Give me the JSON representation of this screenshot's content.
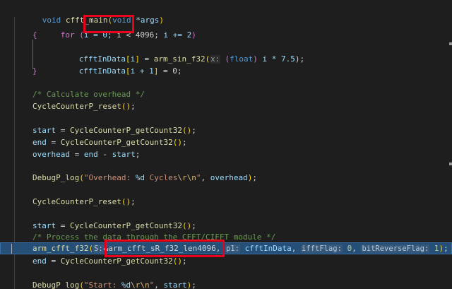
{
  "editor": {
    "function_signature": {
      "keyword": "void",
      "name": "cfft_main",
      "param_type": "void",
      "param_name": "*args"
    },
    "lines": {
      "for": {
        "kw": "for",
        "init": "i = 0;",
        "cond": "i < 4096;",
        "incr": "i += 2"
      },
      "brace_open": "{",
      "sin_call": {
        "target": "cfftInData",
        "index": "i",
        "fn": "arm_sin_f32",
        "hint": "x:",
        "cast": "float",
        "rest": "i * 7.5",
        "end": ");"
      },
      "zero_assign": {
        "target": "cfftInData",
        "index": "i + 1",
        "rest": " = 0;"
      },
      "brace_close": "}",
      "comment_overhead": "/* Calculate overhead */",
      "reset1": "CycleCounterP_reset",
      "start1": {
        "var": "start",
        "fn": "CycleCounterP_getCount32"
      },
      "end1": {
        "var": "end",
        "fn": "CycleCounterP_getCount32"
      },
      "overhead": {
        "var": "overhead",
        "a": "end",
        "b": "start"
      },
      "log_overhead": {
        "fn": "DebugP_log",
        "fmt_a": "\"Overhead: ",
        "fmt_b": "%d",
        "fmt_c": " Cycles",
        "fmt_d": "\\r\\n",
        "fmt_e": "\"",
        "arg": "overhead"
      },
      "reset2": "CycleCounterP_reset",
      "start2": {
        "var": "start",
        "fn": "CycleCounterP_getCount32"
      },
      "comment_process": "/* Process the data through the CFFT/CIFFT module */",
      "cfft_call": {
        "fn": "arm_cfft_f32",
        "hint_s": "S:",
        "instance": "&arm_cfft_sR_f32_len4096",
        "hint_p1": "p1:",
        "p1": "cfftInData",
        "hint_ifft": "ifftFlag:",
        "ifft": "0",
        "hint_bitrev": "bitReverseFlag:",
        "bitrev": "1"
      },
      "end2": {
        "var": "end",
        "fn": "CycleCounterP_getCount32"
      },
      "log_start": {
        "fn": "DebugP_log",
        "fmt_a": "\"Start: ",
        "fmt_b": "%d",
        "fmt_d": "\\r\\n",
        "fmt_e": "\"",
        "arg": "start"
      }
    }
  },
  "colors": {
    "background": "#1e1e1e",
    "current_line": "#264f78",
    "annotation": "#e8001c"
  }
}
